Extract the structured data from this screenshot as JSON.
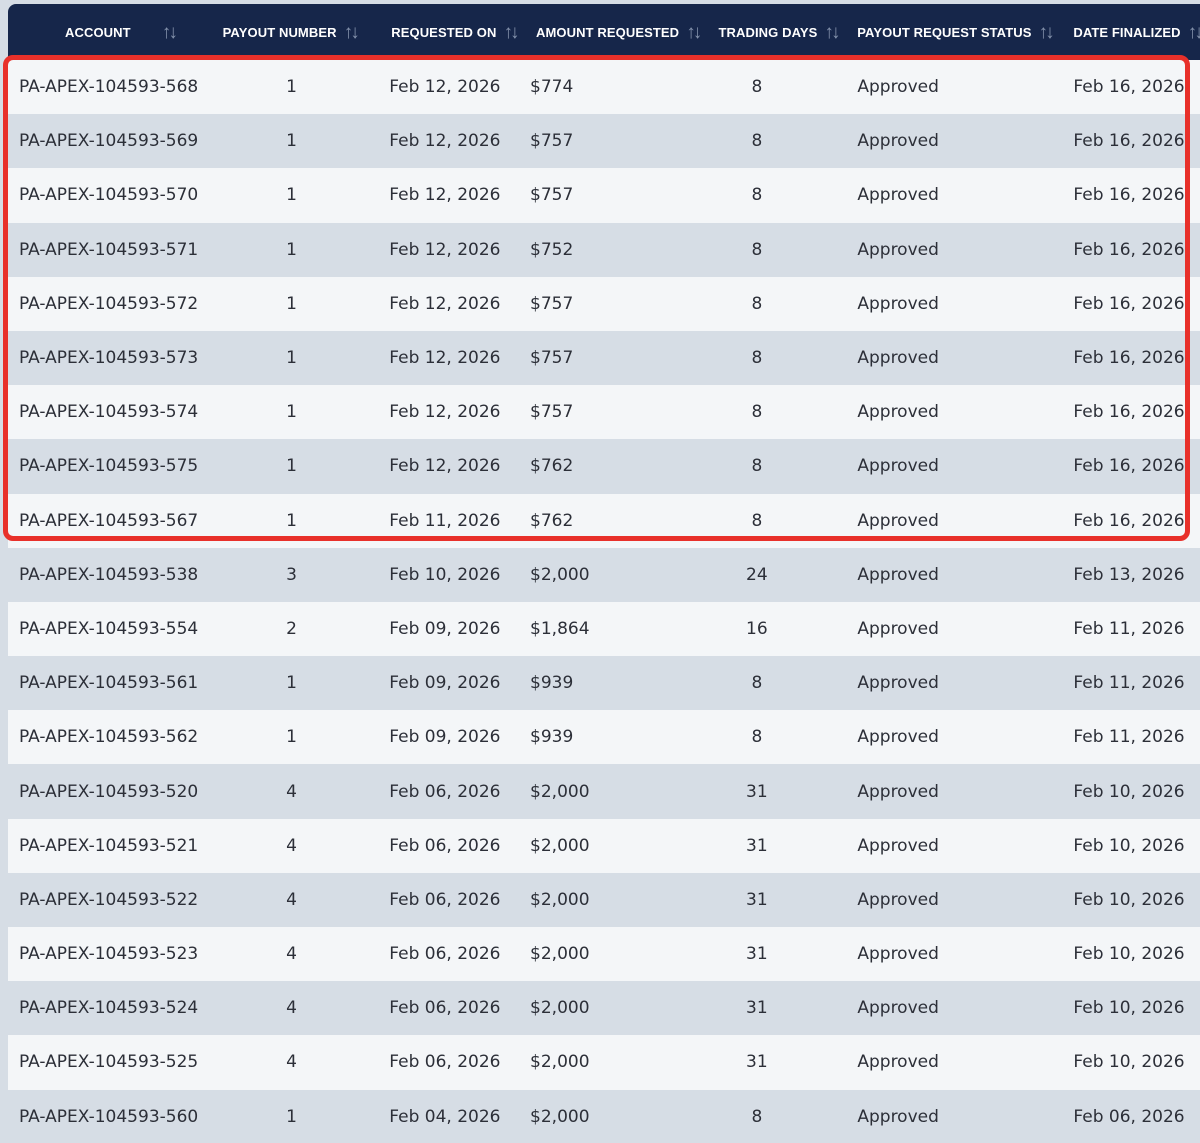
{
  "table": {
    "columns": [
      {
        "key": "account",
        "label": "ACCOUNT"
      },
      {
        "key": "payout",
        "label": "PAYOUT NUMBER"
      },
      {
        "key": "requested",
        "label": "REQUESTED ON"
      },
      {
        "key": "amount",
        "label": "AMOUNT REQUESTED"
      },
      {
        "key": "days",
        "label": "TRADING DAYS"
      },
      {
        "key": "status",
        "label": "PAYOUT REQUEST STATUS"
      },
      {
        "key": "final",
        "label": "DATE FINALIZED"
      }
    ],
    "sort_icon": "sort-arrows-icon",
    "highlight_color": "#e8302a",
    "header_bg": "#16264a",
    "rows": [
      {
        "account": "PA-APEX-104593-568",
        "payout": "1",
        "requested": "Feb 12, 2026",
        "amount": "$774",
        "days": "8",
        "status": "Approved",
        "final": "Feb 16, 2026"
      },
      {
        "account": "PA-APEX-104593-569",
        "payout": "1",
        "requested": "Feb 12, 2026",
        "amount": "$757",
        "days": "8",
        "status": "Approved",
        "final": "Feb 16, 2026"
      },
      {
        "account": "PA-APEX-104593-570",
        "payout": "1",
        "requested": "Feb 12, 2026",
        "amount": "$757",
        "days": "8",
        "status": "Approved",
        "final": "Feb 16, 2026"
      },
      {
        "account": "PA-APEX-104593-571",
        "payout": "1",
        "requested": "Feb 12, 2026",
        "amount": "$752",
        "days": "8",
        "status": "Approved",
        "final": "Feb 16, 2026"
      },
      {
        "account": "PA-APEX-104593-572",
        "payout": "1",
        "requested": "Feb 12, 2026",
        "amount": "$757",
        "days": "8",
        "status": "Approved",
        "final": "Feb 16, 2026"
      },
      {
        "account": "PA-APEX-104593-573",
        "payout": "1",
        "requested": "Feb 12, 2026",
        "amount": "$757",
        "days": "8",
        "status": "Approved",
        "final": "Feb 16, 2026"
      },
      {
        "account": "PA-APEX-104593-574",
        "payout": "1",
        "requested": "Feb 12, 2026",
        "amount": "$757",
        "days": "8",
        "status": "Approved",
        "final": "Feb 16, 2026"
      },
      {
        "account": "PA-APEX-104593-575",
        "payout": "1",
        "requested": "Feb 12, 2026",
        "amount": "$762",
        "days": "8",
        "status": "Approved",
        "final": "Feb 16, 2026"
      },
      {
        "account": "PA-APEX-104593-567",
        "payout": "1",
        "requested": "Feb 11, 2026",
        "amount": "$762",
        "days": "8",
        "status": "Approved",
        "final": "Feb 16, 2026"
      },
      {
        "account": "PA-APEX-104593-538",
        "payout": "3",
        "requested": "Feb 10, 2026",
        "amount": "$2,000",
        "days": "24",
        "status": "Approved",
        "final": "Feb 13, 2026"
      },
      {
        "account": "PA-APEX-104593-554",
        "payout": "2",
        "requested": "Feb 09, 2026",
        "amount": "$1,864",
        "days": "16",
        "status": "Approved",
        "final": "Feb 11, 2026"
      },
      {
        "account": "PA-APEX-104593-561",
        "payout": "1",
        "requested": "Feb 09, 2026",
        "amount": "$939",
        "days": "8",
        "status": "Approved",
        "final": "Feb 11, 2026"
      },
      {
        "account": "PA-APEX-104593-562",
        "payout": "1",
        "requested": "Feb 09, 2026",
        "amount": "$939",
        "days": "8",
        "status": "Approved",
        "final": "Feb 11, 2026"
      },
      {
        "account": "PA-APEX-104593-520",
        "payout": "4",
        "requested": "Feb 06, 2026",
        "amount": "$2,000",
        "days": "31",
        "status": "Approved",
        "final": "Feb 10, 2026"
      },
      {
        "account": "PA-APEX-104593-521",
        "payout": "4",
        "requested": "Feb 06, 2026",
        "amount": "$2,000",
        "days": "31",
        "status": "Approved",
        "final": "Feb 10, 2026"
      },
      {
        "account": "PA-APEX-104593-522",
        "payout": "4",
        "requested": "Feb 06, 2026",
        "amount": "$2,000",
        "days": "31",
        "status": "Approved",
        "final": "Feb 10, 2026"
      },
      {
        "account": "PA-APEX-104593-523",
        "payout": "4",
        "requested": "Feb 06, 2026",
        "amount": "$2,000",
        "days": "31",
        "status": "Approved",
        "final": "Feb 10, 2026"
      },
      {
        "account": "PA-APEX-104593-524",
        "payout": "4",
        "requested": "Feb 06, 2026",
        "amount": "$2,000",
        "days": "31",
        "status": "Approved",
        "final": "Feb 10, 2026"
      },
      {
        "account": "PA-APEX-104593-525",
        "payout": "4",
        "requested": "Feb 06, 2026",
        "amount": "$2,000",
        "days": "31",
        "status": "Approved",
        "final": "Feb 10, 2026"
      },
      {
        "account": "PA-APEX-104593-560",
        "payout": "1",
        "requested": "Feb 04, 2026",
        "amount": "$2,000",
        "days": "8",
        "status": "Approved",
        "final": "Feb 06, 2026"
      }
    ]
  }
}
